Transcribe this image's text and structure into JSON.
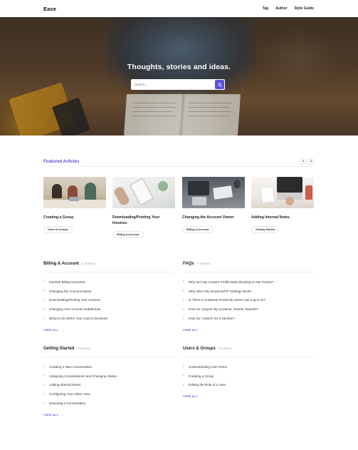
{
  "header": {
    "logo": "Ease",
    "nav": [
      "Tag",
      "Author",
      "Style Guide"
    ]
  },
  "hero": {
    "title": "Thoughts, stories and ideas.",
    "search_placeholder": "Search..."
  },
  "featured": {
    "title": "Featured Articles",
    "prev_icon": "chevron-left-icon",
    "next_icon": "chevron-right-icon",
    "cards": [
      {
        "title": "Creating a Group",
        "tag": "Users & Groups"
      },
      {
        "title": "Downloading/Printing Your Invoices",
        "tag": "Billing & Account"
      },
      {
        "title": "Changing the Account Owner",
        "tag": "Billing & Account"
      },
      {
        "title": "Adding Internal Notes",
        "tag": "Getting Started"
      }
    ]
  },
  "categories": [
    {
      "title": "Billing & Account",
      "count": "5 articles",
      "items": [
        "General Billing Overview",
        "Changing the Account Owner",
        "Downloading/Printing Your Invoices",
        "Changing Your Account Subdomain",
        "What to Do When Your Card is Declined"
      ],
      "view_all": "VIEW ALL"
    },
    {
      "title": "FAQs",
      "count": "7 articles",
      "items": [
        "Why Isn't My Custom Profile Data Showing on My Tickets?",
        "Why Won't My Gmail SMTP Settings Work?",
        "Is There a Customer Portal My Users Can Log In To?",
        "How Do I Export My Contacts, Tickets, Reports?",
        "How Do I Search for a Number?"
      ],
      "view_all": "VIEW ALL"
    },
    {
      "title": "Getting Started",
      "count": "6 articles",
      "items": [
        "Creating a New Conversation",
        "Assigning Conversations and Changing Status",
        "Adding Internal Notes",
        "Configuring Your Inbox View",
        "Snoozing a Conversation"
      ],
      "view_all": "VIEW ALL"
    },
    {
      "title": "Users & Groups",
      "count": "3 articles",
      "items": [
        "Understanding User Roles",
        "Creating a Group",
        "Editing the Role of a User"
      ],
      "view_all": "VIEW ALL"
    }
  ],
  "colors": {
    "accent": "#5b4fd9"
  }
}
